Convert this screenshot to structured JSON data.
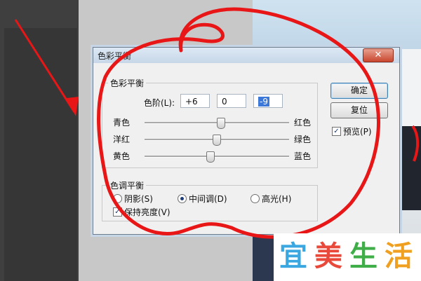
{
  "dialog": {
    "title": "色彩平衡",
    "close_glyph": "✕",
    "color_balance_group": {
      "legend": "色彩平衡",
      "levels_label": "色阶(L):",
      "levels": [
        "+6",
        "0",
        "-9"
      ]
    },
    "sliders": [
      {
        "left_label": "青色",
        "right_label": "红色",
        "value": 6
      },
      {
        "left_label": "洋红",
        "right_label": "绿色",
        "value": 0
      },
      {
        "left_label": "黄色",
        "right_label": "蓝色",
        "value": -9
      }
    ],
    "tone_balance_group": {
      "legend": "色调平衡",
      "options": [
        {
          "label": "阴影(S)",
          "selected": false
        },
        {
          "label": "中间调(D)",
          "selected": true
        },
        {
          "label": "高光(H)",
          "selected": false
        }
      ],
      "preserve_luminosity": {
        "label": "保持亮度(V)",
        "checked": true
      }
    },
    "buttons": {
      "ok": "确定",
      "reset": "复位"
    },
    "preview": {
      "label": "预览(P)",
      "checked": true
    }
  },
  "watermark": {
    "chars": [
      "宜",
      "美",
      "生",
      "活"
    ],
    "colors": [
      "#3aa7e0",
      "#e8493a",
      "#3fae49",
      "#f0a020"
    ]
  },
  "annotation_color": "#e81616"
}
